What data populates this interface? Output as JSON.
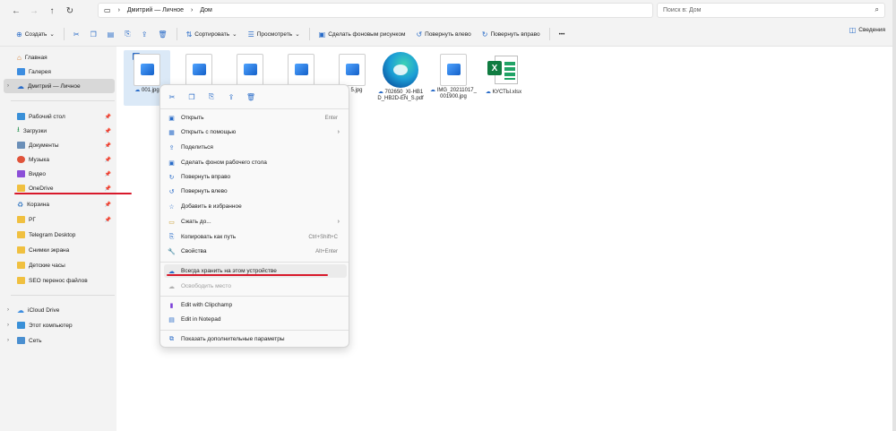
{
  "address": {
    "crumbs": [
      "Дмитрий — Личное",
      "Дом"
    ],
    "search_placeholder": "Поиск в: Дом"
  },
  "toolbar": {
    "create": "Создать",
    "sort": "Сортировать",
    "view": "Просмотреть",
    "set_bg": "Сделать фоновым рисунком",
    "rotate_left": "Повернуть влево",
    "rotate_right": "Повернуть вправо",
    "more": "•••",
    "details": "Сведения"
  },
  "sidebar": {
    "items": [
      {
        "label": "Главная"
      },
      {
        "label": "Галерея"
      },
      {
        "label": "Дмитрий — Личное"
      },
      {
        "label": "Рабочий стол"
      },
      {
        "label": "Загрузки"
      },
      {
        "label": "Документы"
      },
      {
        "label": "Музыка"
      },
      {
        "label": "Видео"
      },
      {
        "label": "OneDrive"
      },
      {
        "label": "Корзина"
      },
      {
        "label": "РГ"
      },
      {
        "label": "Telegram Desktop"
      },
      {
        "label": "Снимки экрана"
      },
      {
        "label": "Детские часы"
      },
      {
        "label": "SEO перенос файлов"
      },
      {
        "label": "iCloud Drive"
      },
      {
        "label": "Этот компьютер"
      },
      {
        "label": "Сеть"
      }
    ]
  },
  "files": [
    {
      "name": "001.jpg"
    },
    {
      "name": ""
    },
    {
      "name": ""
    },
    {
      "name": ""
    },
    {
      "name": "5.jpg"
    },
    {
      "name": "702650_XI-HB1D_HB2D-EN_S.pdf"
    },
    {
      "name": "IMG_20211017_001900.jpg"
    },
    {
      "name": "КУСТЫ.xlsx"
    }
  ],
  "context_menu": {
    "items": [
      {
        "label": "Открыть",
        "shortcut": "Enter"
      },
      {
        "label": "Открыть с помощью"
      },
      {
        "label": "Поделиться"
      },
      {
        "label": "Сделать фоном рабочего стола"
      },
      {
        "label": "Повернуть вправо"
      },
      {
        "label": "Повернуть влево"
      },
      {
        "label": "Добавить в избранное"
      },
      {
        "label": "Сжать до..."
      },
      {
        "label": "Копировать как путь",
        "shortcut": "Ctrl+Shift+C"
      },
      {
        "label": "Свойства",
        "shortcut": "Alt+Enter"
      },
      {
        "label": "Всегда хранить на этом устройстве"
      },
      {
        "label": "Освободить место"
      },
      {
        "label": "Edit with Clipchamp"
      },
      {
        "label": "Edit in Notepad"
      },
      {
        "label": "Показать дополнительные параметры"
      }
    ]
  },
  "colors": {
    "accent": "#2a6cc8",
    "annotation": "#d8192b"
  }
}
